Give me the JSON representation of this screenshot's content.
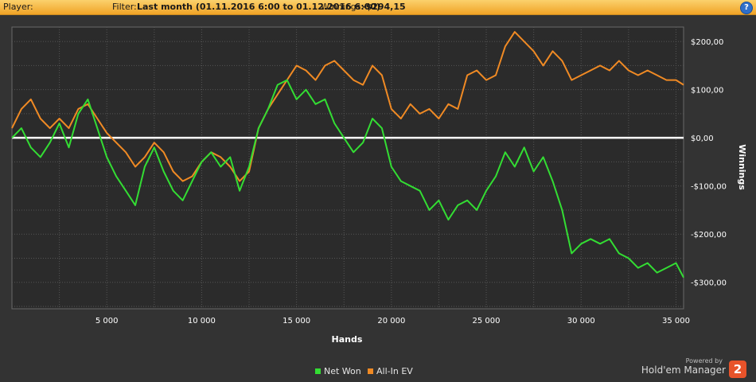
{
  "header": {
    "player_label": "Player:",
    "filter_label": "Filter:",
    "filter_value": "Last month (01.11.2016 6:00 to 01.12.2016 6:00)",
    "winnings_label": "Winnings:",
    "winnings_value": "-$294,15",
    "help_icon": "question-icon"
  },
  "footer": {
    "powered_by": "Powered by",
    "brand": "Hold'em Manager",
    "brand_logo_text": "2"
  },
  "colors": {
    "net_won": "#33dd33",
    "all_in_ev": "#f08a24",
    "zero_line": "#ffffff",
    "grid": "#555555"
  },
  "chart_data": {
    "type": "line",
    "xlabel": "Hands",
    "ylabel": "Winnings",
    "xlim": [
      0,
      35400
    ],
    "ylim": [
      -355,
      230
    ],
    "x_ticks": [
      5000,
      10000,
      15000,
      20000,
      25000,
      30000,
      35000
    ],
    "x_tick_labels": [
      "5 000",
      "10 000",
      "15 000",
      "20 000",
      "25 000",
      "30 000",
      "35 000"
    ],
    "y_ticks": [
      200,
      100,
      0,
      -100,
      -200,
      -300
    ],
    "y_tick_labels": [
      "$200,00",
      "$100,00",
      "$0,00",
      "-$100,00",
      "-$200,00",
      "-$300,00"
    ],
    "grid": true,
    "legend_position": "bottom-center",
    "series": [
      {
        "name": "Net Won",
        "x": [
          0,
          500,
          1000,
          1500,
          2000,
          2500,
          3000,
          3500,
          4000,
          4500,
          5000,
          5500,
          6000,
          6500,
          7000,
          7500,
          8000,
          8500,
          9000,
          9500,
          10000,
          10500,
          11000,
          11500,
          12000,
          12500,
          13000,
          13500,
          14000,
          14500,
          15000,
          15500,
          16000,
          16500,
          17000,
          17500,
          18000,
          18500,
          19000,
          19500,
          20000,
          20500,
          21000,
          21500,
          22000,
          22500,
          23000,
          23500,
          24000,
          24500,
          25000,
          25500,
          26000,
          26500,
          27000,
          27500,
          28000,
          28500,
          29000,
          29500,
          30000,
          30500,
          31000,
          31500,
          32000,
          32500,
          33000,
          33500,
          34000,
          34500,
          35000,
          35400
        ],
        "values": [
          0,
          20,
          -20,
          -40,
          -10,
          30,
          -20,
          50,
          80,
          20,
          -40,
          -80,
          -110,
          -140,
          -60,
          -20,
          -70,
          -110,
          -130,
          -90,
          -50,
          -30,
          -60,
          -40,
          -110,
          -60,
          20,
          60,
          110,
          120,
          80,
          100,
          70,
          80,
          30,
          0,
          -30,
          -10,
          40,
          20,
          -60,
          -90,
          -100,
          -110,
          -150,
          -130,
          -170,
          -140,
          -130,
          -150,
          -110,
          -80,
          -30,
          -60,
          -20,
          -70,
          -40,
          -90,
          -150,
          -240,
          -220,
          -210,
          -220,
          -210,
          -240,
          -250,
          -270,
          -260,
          -280,
          -270,
          -260,
          -290
        ]
      },
      {
        "name": "All-In EV",
        "x": [
          0,
          500,
          1000,
          1500,
          2000,
          2500,
          3000,
          3500,
          4000,
          4500,
          5000,
          5500,
          6000,
          6500,
          7000,
          7500,
          8000,
          8500,
          9000,
          9500,
          10000,
          10500,
          11000,
          11500,
          12000,
          12500,
          13000,
          13500,
          14000,
          14500,
          15000,
          15500,
          16000,
          16500,
          17000,
          17500,
          18000,
          18500,
          19000,
          19500,
          20000,
          20500,
          21000,
          21500,
          22000,
          22500,
          23000,
          23500,
          24000,
          24500,
          25000,
          25500,
          26000,
          26500,
          27000,
          27500,
          28000,
          28500,
          29000,
          29500,
          30000,
          30500,
          31000,
          31500,
          32000,
          32500,
          33000,
          33500,
          34000,
          34500,
          35000,
          35400
        ],
        "values": [
          20,
          60,
          80,
          40,
          20,
          40,
          20,
          60,
          70,
          40,
          10,
          -10,
          -30,
          -60,
          -40,
          -10,
          -30,
          -70,
          -90,
          -80,
          -50,
          -30,
          -40,
          -60,
          -90,
          -70,
          20,
          60,
          90,
          120,
          150,
          140,
          120,
          150,
          160,
          140,
          120,
          110,
          150,
          130,
          60,
          40,
          70,
          50,
          60,
          40,
          70,
          60,
          130,
          140,
          120,
          130,
          190,
          220,
          200,
          180,
          150,
          180,
          160,
          120,
          130,
          140,
          150,
          140,
          160,
          140,
          130,
          140,
          130,
          120,
          120,
          110
        ]
      }
    ]
  }
}
